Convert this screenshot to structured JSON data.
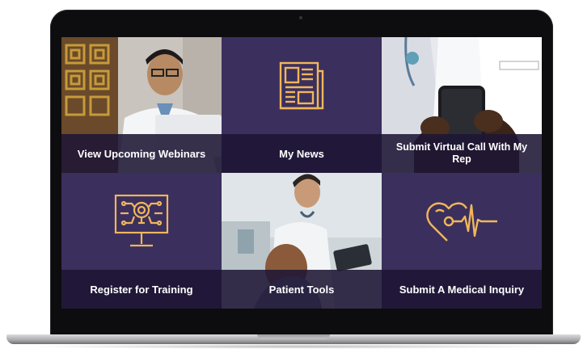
{
  "tiles": {
    "webinars": {
      "label": "View Upcoming Webinars"
    },
    "news": {
      "label": "My News"
    },
    "virtual_call": {
      "label": "Submit Virtual Call With My Rep"
    },
    "training": {
      "label": "Register for Training"
    },
    "patient_tools": {
      "label": "Patient Tools"
    },
    "medical_inquiry": {
      "label": "Submit A Medical Inquiry"
    }
  },
  "colors": {
    "tile_bg": "#3b2f5e",
    "caption_bg": "#1e1634",
    "icon_gold": "#f0b65a"
  },
  "icons": {
    "news": "newspaper-icon",
    "training": "presentation-board-icon",
    "medical_inquiry": "heart-stethoscope-icon"
  }
}
